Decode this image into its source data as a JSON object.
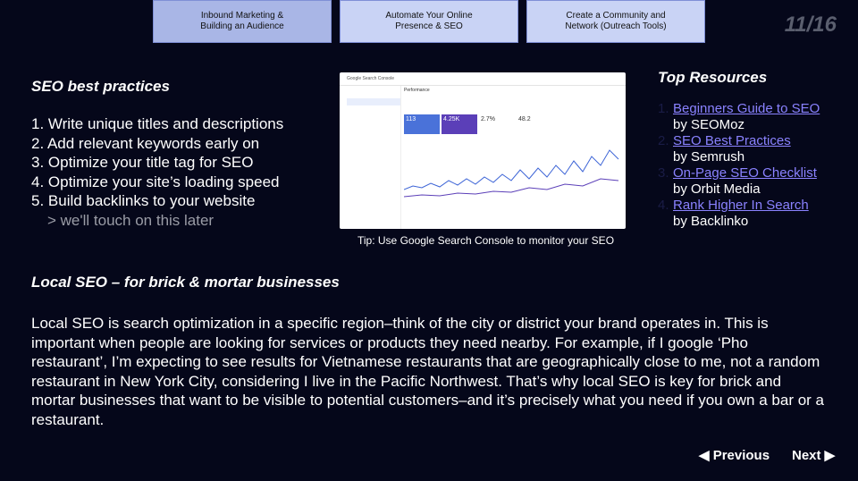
{
  "tabs": [
    {
      "label": "Inbound Marketing &\nBuilding an Audience",
      "active": true
    },
    {
      "label": "Automate Your Online\nPresence & SEO",
      "active": false
    },
    {
      "label": "Create a Community and\nNetwork (Outreach Tools)",
      "active": false
    }
  ],
  "slide_counter": "11/16",
  "seo": {
    "title": "SEO best practices",
    "items": [
      "1. Write unique titles and descriptions",
      "2. Add relevant keywords early on",
      "3. Optimize your title tag for SEO",
      "4. Optimize your site’s loading speed",
      "5. Build backlinks to your website"
    ],
    "subitem": "> we'll touch on this later"
  },
  "gsc": {
    "app_title": "Google Search Console",
    "section": "Performance",
    "metrics": [
      "113",
      "4.25K",
      "2.7%",
      "48.2"
    ],
    "caption": "Tip: Use Google Search Console to monitor your SEO"
  },
  "resources": {
    "title": "Top Resources",
    "items": [
      {
        "num": "1.",
        "link": "Beginners Guide to SEO",
        "by": "by SEOMoz"
      },
      {
        "num": "2.",
        "link": "SEO Best Practices",
        "by": "by Semrush"
      },
      {
        "num": "3.",
        "link": "On-Page SEO Checklist",
        "by": "by Orbit Media"
      },
      {
        "num": "4.",
        "link": "Rank Higher In Search",
        "by": "by Backlinko"
      }
    ]
  },
  "local": {
    "title": "Local SEO – for brick & mortar businesses",
    "body": "Local SEO is search optimization in a specific region–think of the city or district your brand operates in. This is important when people are looking for services or products they need nearby. For example, if I google ‘Pho restaurant’, I’m expecting to see results for Vietnamese restaurants that are geographically close to me, not a random restaurant in New York City, considering I live in the Pacific Northwest. That’s why local SEO is key for brick and mortar businesses that want to be visible to potential customers–and it’s precisely what you need if you own a bar or a restaurant."
  },
  "nav": {
    "previous": "◀ Previous",
    "next": "Next ▶"
  }
}
